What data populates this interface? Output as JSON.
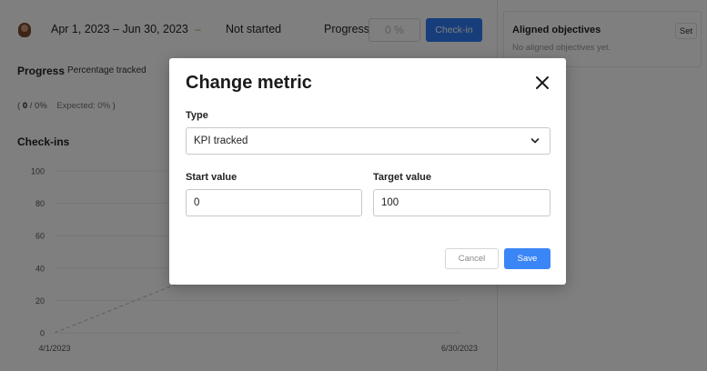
{
  "header": {
    "date_range": "Apr 1, 2023 – Jun 30, 2023",
    "status_dash": "–",
    "status": "Not started",
    "progress_label": "Progress",
    "progress_value": "0 %",
    "checkin_label": "Check-in"
  },
  "progress_section": {
    "heading": "Progress",
    "tracking_mode": "Percentage tracked",
    "current": "0",
    "percent": "0%",
    "expected": "Expected: 0%"
  },
  "checkins": {
    "heading": "Check-ins"
  },
  "chart_data": {
    "type": "line",
    "x_ticks": [
      "4/1/2023",
      "6/30/2023"
    ],
    "y_ticks": [
      0,
      20,
      40,
      60,
      80,
      100
    ],
    "ylim": [
      0,
      100
    ]
  },
  "aligned": {
    "title": "Aligned objectives",
    "empty_text": "No aligned objectives yet.",
    "set_label": "Set"
  },
  "modal": {
    "title": "Change metric",
    "type_label": "Type",
    "type_value": "KPI tracked",
    "start_label": "Start value",
    "start_value": "0",
    "target_label": "Target value",
    "target_value": "100",
    "cancel_label": "Cancel",
    "save_label": "Save"
  },
  "colors": {
    "primary": "#3b86f7",
    "overlay": "rgba(0,0,0,0.5)"
  }
}
